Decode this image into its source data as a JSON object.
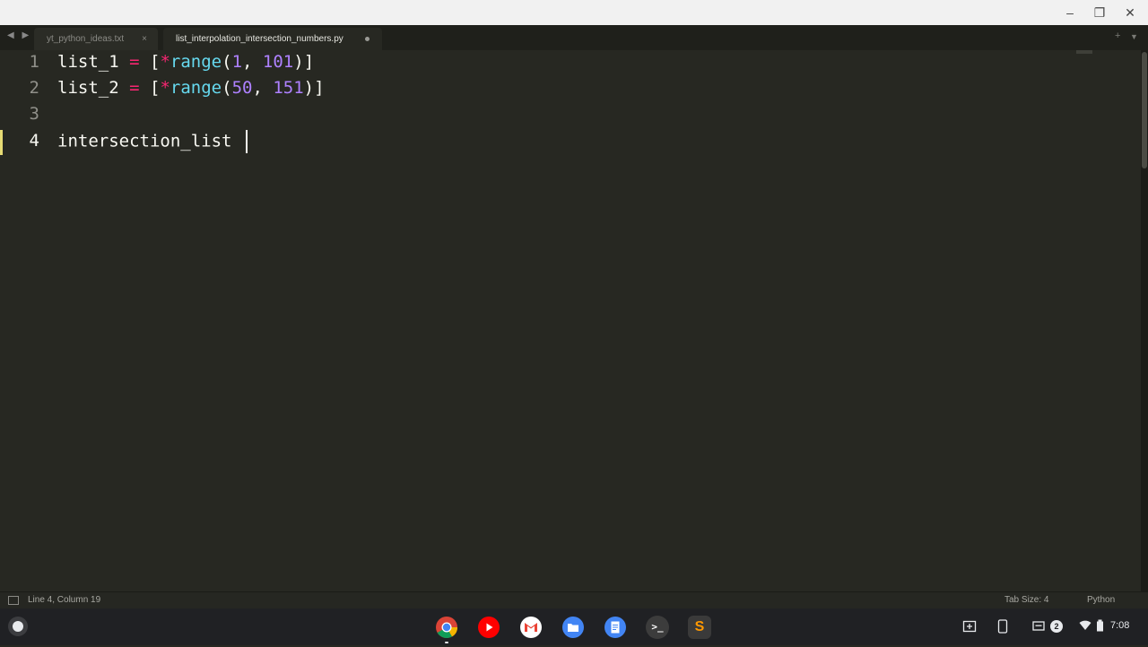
{
  "window": {
    "minimize": "–",
    "maximize": "❐",
    "close": "✕"
  },
  "tabs": [
    {
      "label": "yt_python_ideas.txt",
      "close": "×"
    },
    {
      "label": "list_interpolation_intersection_numbers.py"
    }
  ],
  "tabbar": {
    "nav": "◀ ▶",
    "new_tab": "+",
    "menu": "▼"
  },
  "editor": {
    "line_numbers": [
      "1",
      "2",
      "3",
      "4"
    ],
    "line1": {
      "var": "list_1",
      "eq": "=",
      "open": "[",
      "star": "*",
      "fn": "range",
      "lp": "(",
      "a": "1",
      "comma": ", ",
      "b": "101",
      "rp": ")",
      "close": "]"
    },
    "line2": {
      "var": "list_2",
      "eq": "=",
      "open": "[",
      "star": "*",
      "fn": "range",
      "lp": "(",
      "a": "50",
      "comma": ", ",
      "b": "151",
      "rp": ")",
      "close": "]"
    },
    "line4": {
      "text": "intersection_list"
    }
  },
  "status": {
    "position": "Line 4, Column 19",
    "tab_size": "Tab Size: 4",
    "syntax": "Python"
  },
  "shelf": {
    "apps": [
      {
        "name": "chrome",
        "color": "#4285f4"
      },
      {
        "name": "youtube",
        "color": "#ff0000"
      },
      {
        "name": "gmail",
        "color": "#ffffff"
      },
      {
        "name": "files",
        "color": "#4285f4"
      },
      {
        "name": "docs",
        "color": "#4285f4"
      },
      {
        "name": "terminal",
        "color": "#3c3c3c"
      },
      {
        "name": "sublime-text",
        "color": "#ff9800"
      }
    ],
    "terminal_glyph": ">_",
    "sublime_glyph": "S",
    "notification_count": "2",
    "time": "7:08"
  }
}
